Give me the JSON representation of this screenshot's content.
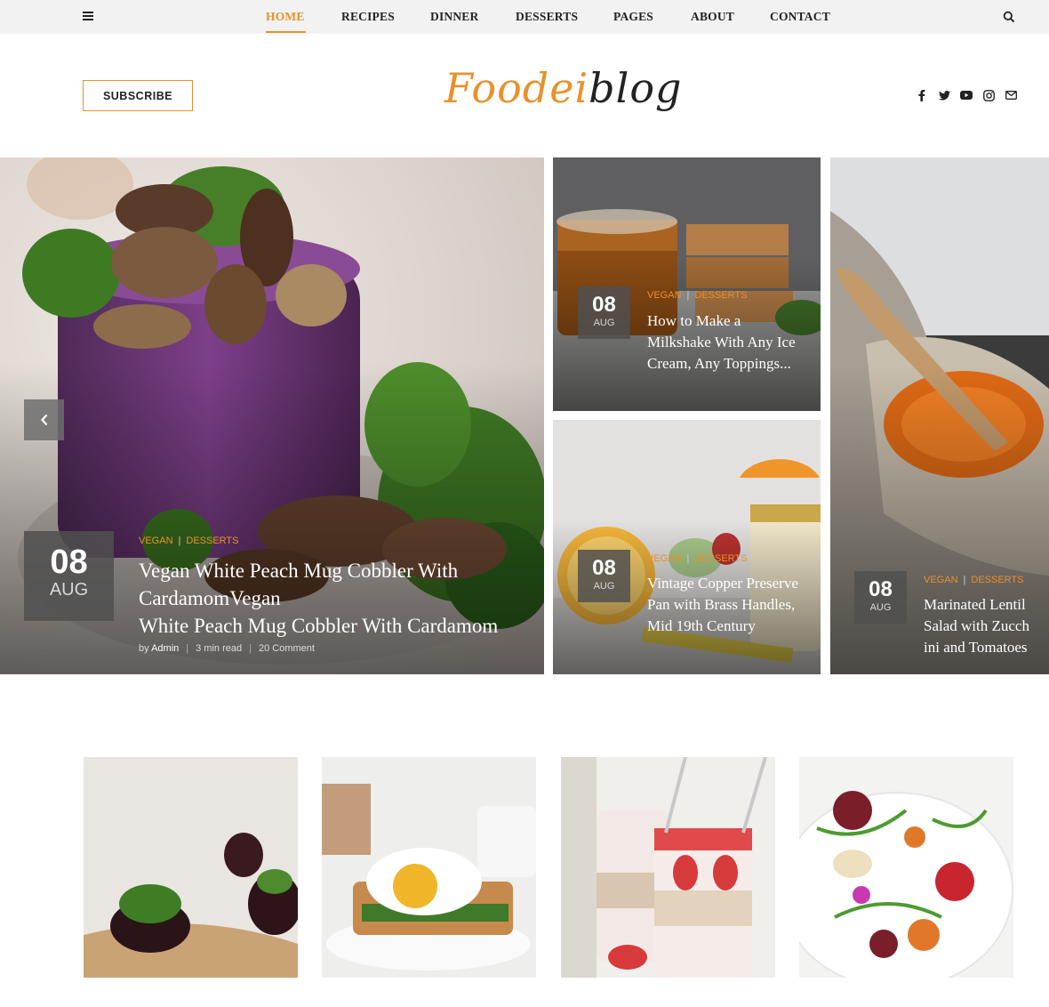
{
  "nav": {
    "items": [
      {
        "label": "HOME",
        "active": true
      },
      {
        "label": "RECIPES",
        "active": false
      },
      {
        "label": "DINNER",
        "active": false
      },
      {
        "label": "DESSERTS",
        "active": false
      },
      {
        "label": "PAGES",
        "active": false
      },
      {
        "label": "ABOUT",
        "active": false
      },
      {
        "label": "CONTACT",
        "active": false
      }
    ],
    "menu_icon": "hamburger-icon",
    "search_icon": "search-icon"
  },
  "header": {
    "subscribe_label": "SUBSCRIBE",
    "logo_part1": "Foodei",
    "logo_part2": "blog",
    "social": [
      "facebook-icon",
      "twitter-icon",
      "youtube-icon",
      "instagram-icon",
      "email-icon"
    ]
  },
  "colors": {
    "accent": "#e8912d",
    "text": "#222222",
    "nav_bg": "#f2f2f2"
  },
  "featured": {
    "day": "08",
    "month": "AUG",
    "categories": [
      "VEGAN",
      "DESSERTS"
    ],
    "title_line1": "Vegan White Peach Mug Cobbler With",
    "title_line2": "CardamomVegan",
    "title_line3": "White Peach Mug Cobbler With Cardamom",
    "by": "by",
    "author": "Admin",
    "read_time": "3 min read",
    "comments": "20 Comment"
  },
  "cards": [
    {
      "day": "08",
      "month": "AUG",
      "categories": [
        "VEGAN",
        "DESSERTS"
      ],
      "title": "How to Make a Milkshake With Any Ice Cream, Any Toppings..."
    },
    {
      "day": "08",
      "month": "AUG",
      "categories": [
        "VEGAN",
        "DESSERTS"
      ],
      "title": "Vintage Copper Preserve Pan with Brass Handles, Mid 19th Century"
    },
    {
      "day": "08",
      "month": "AUG",
      "categories": [
        "VEGAN",
        "DESSERTS"
      ],
      "title": "Marinated Lentil Salad with Zucch ini and Tomatoes"
    }
  ],
  "thumbnails": [
    "beet-appetizer-image",
    "egg-sandwich-image",
    "yogurt-parfait-image",
    "tomato-salad-image"
  ]
}
